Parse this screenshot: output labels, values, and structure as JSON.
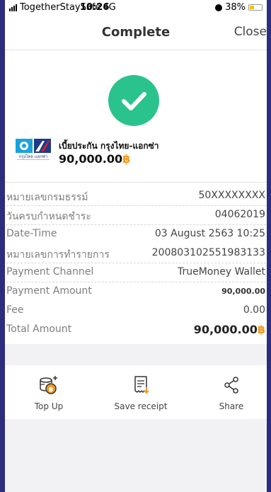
{
  "status_bar": {
    "carrier": "TogetherStaySafe",
    "network": "4G",
    "time": "10:26",
    "battery": "38%",
    "battery_level": 0.38
  },
  "header": {
    "title": "Complete",
    "close_label": "Close"
  },
  "result": {
    "status_icon": "check-icon",
    "accent_color": "#2bc38d"
  },
  "biller": {
    "logo_text": "กรุงไทย แอกซ่า",
    "name": "เบี้ยประกัน กรุงไทย-แอกซ่า",
    "amount": "90,000.00",
    "currency_symbol": "฿"
  },
  "details": [
    {
      "label": "หมายเลขกรมธรรม์",
      "value": "50XXXXXXXX"
    },
    {
      "label": "วันครบกำหนดชำระ",
      "value": "04062019"
    },
    {
      "label": "Date-Time",
      "value": "03 August 2563 10:25"
    },
    {
      "label": "หมายเลขการทำรายการ",
      "value": "200803102551983133"
    },
    {
      "label": "Payment Channel",
      "value": "TrueMoney Wallet"
    }
  ],
  "payment": {
    "amount_label": "Payment Amount",
    "amount_value": "90,000.00",
    "fee_label": "Fee",
    "fee_value": "0.00",
    "total_label": "Total Amount",
    "total_value": "90,000.00",
    "currency_symbol": "฿"
  },
  "actions": {
    "topup_label": "Top Up",
    "save_receipt_label": "Save receipt",
    "share_label": "Share"
  }
}
